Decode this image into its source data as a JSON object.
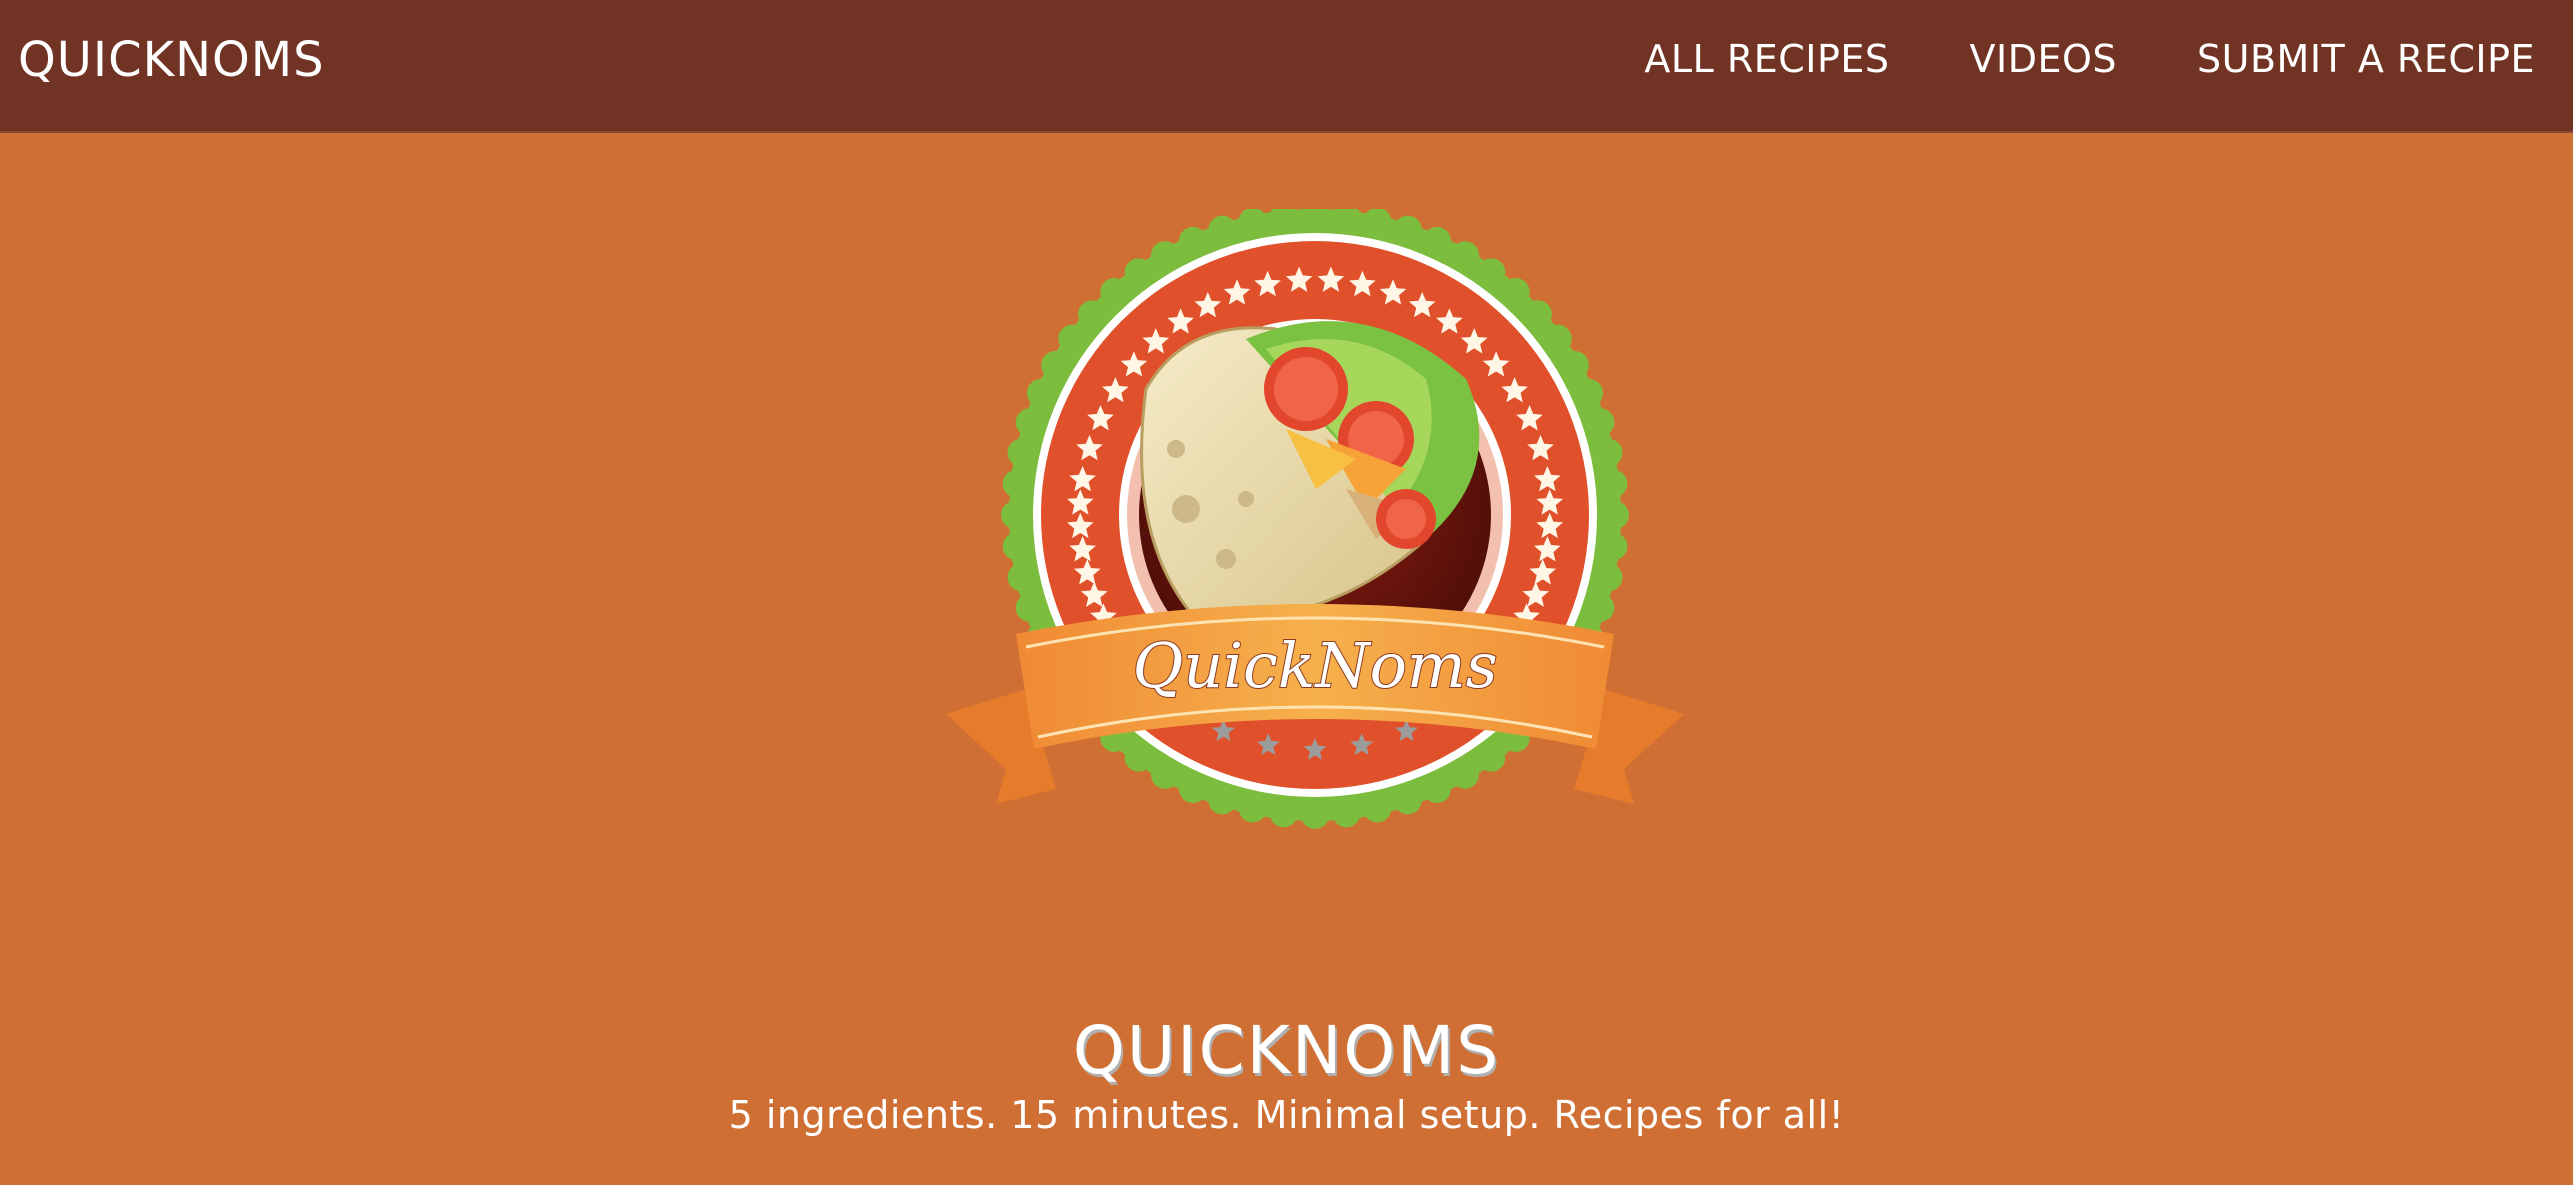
{
  "navbar": {
    "brand": "QUICKNOMS",
    "links": [
      {
        "label": "ALL RECIPES"
      },
      {
        "label": "VIDEOS"
      },
      {
        "label": "SUBMIT A RECIPE"
      }
    ]
  },
  "hero": {
    "logo_text": "QuickNoms",
    "title": "QUICKNOMS",
    "tagline": "5 ingredients. 15 minutes. Minimal setup. Recipes for all!"
  },
  "colors": {
    "navbar": "#713424",
    "background": "#cf6f33",
    "badge_green": "#7dbd3d",
    "badge_red": "#e0502a",
    "ribbon_orange": "#f29a3d"
  }
}
